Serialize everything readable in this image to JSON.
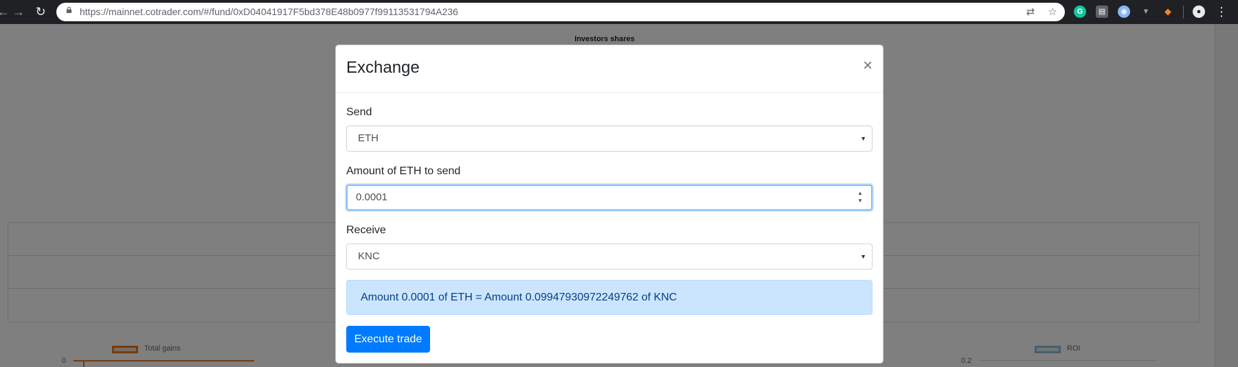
{
  "browser": {
    "url": "https://mainnet.cotrader.com/#/fund/0xD04041917F5bd378E48b0977f99113531794A236",
    "extensions": [
      {
        "name": "grammarly-extension-icon",
        "letter": "G",
        "color": "#15c39a"
      },
      {
        "name": "extension-icon-2",
        "letter": "▤",
        "color": "#9aa0a6"
      },
      {
        "name": "extension-icon-3",
        "letter": "◉",
        "color": "#8ab4f8"
      },
      {
        "name": "vue-devtools-extension-icon",
        "letter": "▼",
        "color": "#9aa0a6"
      },
      {
        "name": "metamask-extension-icon",
        "letter": "🦊",
        "color": "#f6851b"
      }
    ]
  },
  "background_page": {
    "title": "Investors shares",
    "legends": {
      "left": "Total gains",
      "right": "ROI"
    },
    "ticks": {
      "left_y": "0",
      "right_y": "0.2"
    },
    "colors": {
      "legend_left": "#e8761b",
      "legend_right": "#8fbcd4"
    }
  },
  "modal": {
    "title": "Exchange",
    "close_symbol": "×",
    "send": {
      "label": "Send",
      "selected": "ETH"
    },
    "amount": {
      "label": "Amount of ETH to send",
      "value": "0.0001"
    },
    "receive": {
      "label": "Receive",
      "selected": "KNC"
    },
    "result_text": "Amount 0.0001 of ETH = Amount 0.09947930972249762 of KNC",
    "execute_label": "Execute trade",
    "colors": {
      "primary": "#007bff",
      "alert_bg": "#cce5ff",
      "alert_text": "#004085",
      "focus_border": "#80bdff"
    }
  }
}
